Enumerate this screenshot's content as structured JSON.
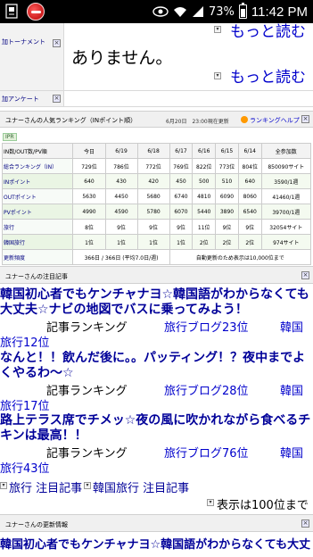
{
  "status_bar": {
    "battery": "73%",
    "time": "11:42 PM"
  },
  "tournament": {
    "side_label": "加トーナメント",
    "more_link_top": "もっと読む",
    "body": "ありません。",
    "more_link": "もっと読む"
  },
  "survey": {
    "side_label": "加アンケート"
  },
  "ranking": {
    "header": "ユナーさんの人気ランキング（INポイント順）",
    "date_note": "6月20日　23:00現在更新",
    "help_link": "ランキングヘルプ",
    "badge": "IPR",
    "columns": [
      "IN数/OUT数/PV順",
      "今日",
      "6/19",
      "6/18",
      "6/17",
      "6/16",
      "6/15",
      "6/14",
      "全参加数"
    ],
    "rows": [
      [
        "総合ランキング（IN）",
        "729位",
        "786位",
        "772位",
        "769位",
        "822位",
        "773位",
        "804位",
        "850090サイト"
      ],
      [
        "INポイント",
        "640",
        "430",
        "420",
        "450",
        "500",
        "510",
        "640",
        "3590/1週"
      ],
      [
        "OUTポイント",
        "5630",
        "4450",
        "5680",
        "6740",
        "4810",
        "6090",
        "8060",
        "41460/1週"
      ],
      [
        "PVポイント",
        "4990",
        "4590",
        "5780",
        "6070",
        "5440",
        "3890",
        "6540",
        "39700/1週"
      ],
      [
        "旅行",
        "8位",
        "9位",
        "9位",
        "9位",
        "11位",
        "9位",
        "9位",
        "32054サイト"
      ],
      [
        "韓国旅行",
        "1位",
        "1位",
        "1位",
        "1位",
        "2位",
        "2位",
        "2位",
        "974サイト"
      ],
      [
        "更新頻度",
        "366日 / 366日 (平均7.0日/週)",
        "",
        "",
        "",
        "",
        "",
        "",
        "自動更新のため表示は10,000位まで"
      ]
    ]
  },
  "notice": {
    "header": "ユナーさんの注目記事",
    "posts": [
      {
        "title_line1": "韓国初心者でもケンチャナヨ☆韓国語がわからなくても",
        "title_line2": "大丈夫☆ナビの地図でバスに乗ってみよう！",
        "category": "記事ランキング",
        "blog": "旅行ブログ23位",
        "region": "韓国",
        "rank_line": "旅行12位"
      },
      {
        "title_line1": "なんと！！飲んだ後に。。パッティング！？夜中までよ",
        "title_line2": "くやるわ〜☆",
        "category": "記事ランキング",
        "blog": "旅行ブログ28位",
        "region": "韓国",
        "rank_line": "旅行17位"
      },
      {
        "title_line1": "路上テラス席でチメッ☆夜の風に吹かれながら食べるチ",
        "title_line2": "キンは最高！！",
        "category": "記事ランキング",
        "blog": "旅行ブログ76位",
        "region": "韓国",
        "rank_line": "旅行43位"
      }
    ],
    "tag1": "旅行 注目記事",
    "tag2": "韓国旅行 注目記事",
    "show_more": "表示は100位まで"
  },
  "updates": {
    "header": "ユナーさんの更新情報",
    "post_line1": "韓国初心者でもケンチャナヨ☆韓国語がわからなくても大丈"
  }
}
